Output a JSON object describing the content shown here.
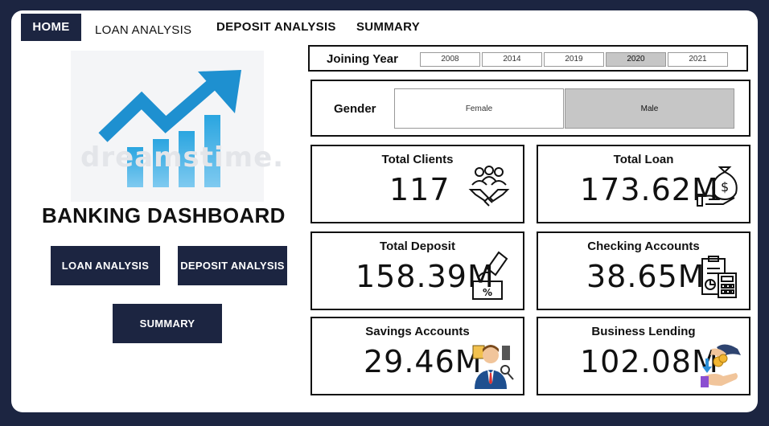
{
  "nav": {
    "tabs": [
      "HOME",
      "LOAN ANALYSIS",
      "DEPOSIT ANALYSIS",
      "SUMMARY"
    ],
    "active_tab": "HOME",
    "active_color": "#1c2541"
  },
  "logo": {
    "watermark": "dreamstime."
  },
  "page_title": "BANKING DASHBOARD",
  "buttons": {
    "loan": "LOAN ANALYSIS",
    "deposit": "DEPOSIT ANALYSIS",
    "summary": "SUMMARY"
  },
  "joining_year": {
    "label": "Joining Year",
    "options": [
      "2008",
      "2014",
      "2019",
      "2020",
      "2021"
    ],
    "selected": "2020"
  },
  "gender": {
    "label": "Gender",
    "options": [
      "Female",
      "Male"
    ],
    "selected": "Male"
  },
  "kpis": {
    "total_clients": {
      "title": "Total Clients",
      "value": "117",
      "icon": "people-handshake-icon"
    },
    "total_loan": {
      "title": "Total Loan",
      "value": "173.62M",
      "icon": "money-bag-hand-icon"
    },
    "total_deposit": {
      "title": "Total Deposit",
      "value": "158.39M",
      "icon": "deposit-box-icon"
    },
    "checking_accounts": {
      "title": "Checking Accounts",
      "value": "38.65M",
      "icon": "calculator-clipboard-icon"
    },
    "savings_accounts": {
      "title": "Savings Accounts",
      "value": "29.46M",
      "icon": "businessman-icon"
    },
    "business_lending": {
      "title": "Business Lending",
      "value": "102.08M",
      "icon": "coins-hand-icon"
    }
  },
  "colors": {
    "brand_dark": "#1c2541",
    "accent_blue": "#2aa5e0",
    "selected_gray": "#c6c6c6"
  }
}
